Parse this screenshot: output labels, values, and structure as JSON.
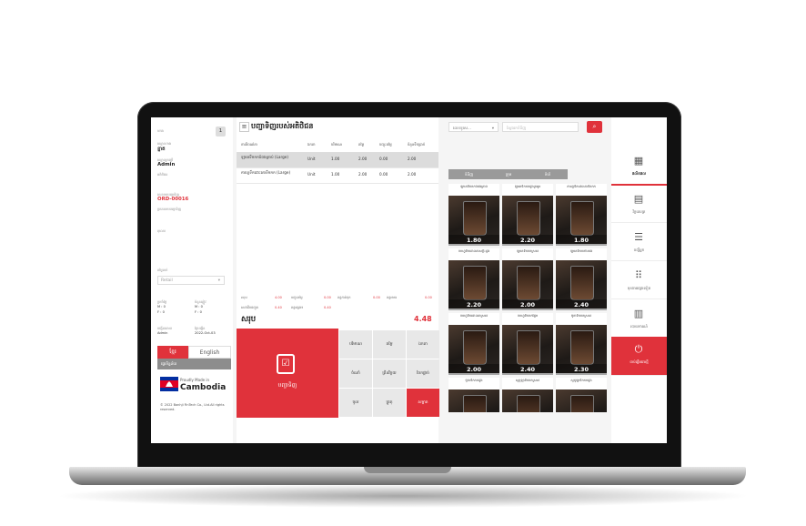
{
  "colors": {
    "accent": "#e0323b",
    "sidebar_button": "#8d8d8d"
  },
  "sidebar": {
    "shop_label": "ហាង",
    "shop_badge": "1",
    "shop_name_label": "ឈ្មោះហាង",
    "shop_name": "ខ្នាត",
    "user_label": "ឈ្មោះអ្នកប្រើ",
    "user_name": "Admin",
    "customer_label": "អតិថិជន",
    "order_label": "លេខការបញ្ជាទិញ",
    "order_no": "ORD-00016",
    "order_type_label": "ប្រភេទការបញ្ជាទិញ",
    "table_label": "តុលេខ",
    "price_label": "តម្លៃលក់",
    "price_select": "Retail",
    "stats": [
      {
        "label": "ប្រចាំថ្ងៃ",
        "line1": "M : 0",
        "line2": "F : 0"
      },
      {
        "label": "ចំនួនភ្ញៀវ",
        "line1": "M : 0",
        "line2": "F : 0"
      }
    ],
    "created_by_label": "បង្កើតដោយ",
    "created_by": "Admin",
    "created_date_label": "ថ្ងៃបង្កើត",
    "created_date": "2022-Oct-03",
    "lang_khmer": "ខ្មែរ",
    "lang_english": "English",
    "sync_button": "ផ្ទេរទិន្នន័យ",
    "made_in_small": "Proudly Made in",
    "made_in_country": "Cambodia",
    "copyright": "© 2022 Banhji FinTech Co., Ltd.All rights reserved."
  },
  "order": {
    "title": "បញ្ជាទិញរបស់អតិថិជន",
    "columns": [
      "ការពិពណ៌នា",
      "ឯកតា",
      "បរិមាណ",
      "តម្លៃ",
      "បញ្ចុះតម្លៃ",
      "ចំនួនទឹកប្រាក់"
    ],
    "rows": [
      {
        "name": "ឡាតេទឹកកកបំពងគ្រាប់ (Large)",
        "unit": "Unit",
        "qty": "1.00",
        "price": "2.00",
        "discount": "0.00",
        "amount": "2.00"
      },
      {
        "name": "កាហ្វេទឹកដោះគោទឹកកក (Large)",
        "unit": "Unit",
        "qty": "1.00",
        "price": "2.00",
        "discount": "0.00",
        "amount": "2.00"
      }
    ],
    "totals": [
      {
        "label": "សរុប",
        "value": "4.00"
      },
      {
        "label": "បញ្ចុះតម្លៃ",
        "value": "0.00"
      },
      {
        "label": "ពន្ធកាត់ទុក",
        "value": "0.00"
      },
      {
        "label": "ពន្ធអាករ",
        "value": "0.00"
      },
      {
        "label": "សេវាដឹកជញ្ជូន",
        "value": "0.40"
      },
      {
        "label": "ពន្ធផ្សេងៗ",
        "value": "0.40"
      }
    ],
    "sum_label": "សរុប",
    "sum_value": "4.48",
    "pay_label": "បញ្ជាទិញ",
    "actions": [
      "បរិមាណ",
      "តម្លៃ",
      "ឯកតា",
      "ចំណាំ",
      "ព្រីនវិក្កយ",
      "ចែកផ្តាច់",
      "ចូល",
      "ប្តូរតុ",
      "សម្អាត"
    ]
  },
  "products": {
    "category_select": "លេខទូរស...",
    "search_placeholder": "ស្វែងរកទំនិញ",
    "tabs": [
      "ទំនិញ",
      "ក្រុម",
      "ទំហំ"
    ],
    "items": [
      {
        "name": "ឡាតេទឹកកកបំពងគ្រាប់",
        "price": "1.80"
      },
      {
        "name": "ឡាតេទឹកកកដូងក្រអូប",
        "price": "2.20"
      },
      {
        "name": "កាហ្វេទឹកដោះគោទឹកកក",
        "price": "1.80"
      },
      {
        "name": "កាហ្វេទឹកដោះគោសខ្ទិះដូង",
        "price": "2.20"
      },
      {
        "name": "ឡាតេទឹកកកស្រស់",
        "price": "2.00"
      },
      {
        "name": "ឡាតេទឹកកកបៃតង",
        "price": "2.40"
      },
      {
        "name": "កាហ្វេទឹកដោះគោស្រស់",
        "price": "2.00"
      },
      {
        "name": "កាហ្វេទឹកកកផ្អែម",
        "price": "2.40"
      },
      {
        "name": "ម៉ូកាទឹកកកស្រស់",
        "price": "2.30"
      },
      {
        "name": "ម៉ូកាទឹកកកដូង",
        "price": ""
      },
      {
        "name": "សូកូឡាទឹកកកស្រស់",
        "price": ""
      },
      {
        "name": "សូកូឡាទឹកកកដូង",
        "price": ""
      }
    ]
  },
  "nav": [
    {
      "label": "ផលិតផល",
      "icon": "grid-icon"
    },
    {
      "label": "វិក្កយបត្រ",
      "icon": "invoice-icon"
    },
    {
      "label": "បញ្ជីអ្នក",
      "icon": "list-icon"
    },
    {
      "label": "មុខងារផ្សេងទៀត",
      "icon": "dots-icon"
    },
    {
      "label": "របាយការណ៍",
      "icon": "report-icon"
    },
    {
      "label": "ចាប់ផ្តើមវេនថ្មី",
      "icon": "power-icon"
    }
  ]
}
